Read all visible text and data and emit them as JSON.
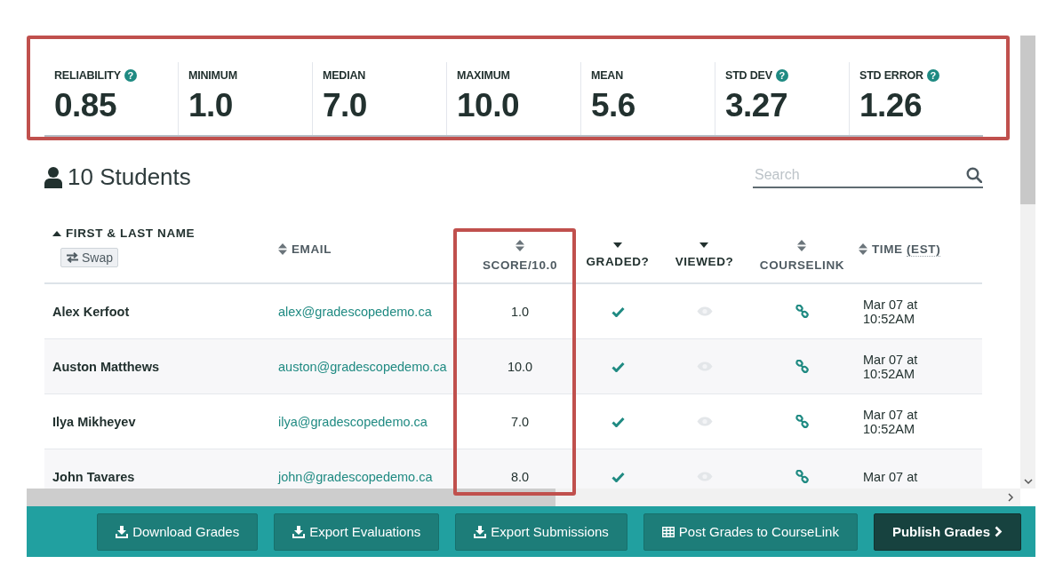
{
  "stats": {
    "highlighted": true,
    "items": [
      {
        "label": "RELIABILITY",
        "value": "0.85",
        "help": "?"
      },
      {
        "label": "MINIMUM",
        "value": "1.0"
      },
      {
        "label": "MEDIAN",
        "value": "7.0"
      },
      {
        "label": "MAXIMUM",
        "value": "10.0"
      },
      {
        "label": "MEAN",
        "value": "5.6"
      },
      {
        "label": "STD DEV",
        "value": "3.27",
        "help": "?"
      },
      {
        "label": "STD ERROR",
        "value": "1.26",
        "help": "?"
      }
    ]
  },
  "students": {
    "title": "10 Students"
  },
  "search": {
    "placeholder": "Search"
  },
  "table": {
    "columns": [
      {
        "label": "FIRST & LAST NAME",
        "kind": "name",
        "sorted_ascending": true,
        "sorted_descending": false,
        "action": "Swap"
      },
      {
        "label": "EMAIL",
        "kind": "email",
        "sorted_ascending": false,
        "sorted_descending": false
      },
      {
        "label": "SCORE/10.0",
        "kind": "score",
        "sorted_ascending": false,
        "sorted_descending": false,
        "highlighted": true
      },
      {
        "label": "GRADED?",
        "kind": "graded",
        "sorted_ascending": false,
        "sorted_descending": true
      },
      {
        "label": "VIEWED?",
        "kind": "viewed",
        "sorted_ascending": false,
        "sorted_descending": true
      },
      {
        "label": "COURSELINK",
        "kind": "courselink",
        "sorted_ascending": false,
        "sorted_descending": false
      },
      {
        "label": "TIME",
        "abbr": "(EST)",
        "kind": "time",
        "sorted_ascending": false,
        "sorted_descending": false
      }
    ],
    "rows": [
      {
        "name": "Alex Kerfoot",
        "email": "alex@gradescopedemo.ca",
        "score": "1.0",
        "graded": true,
        "viewed": false,
        "linked": true,
        "time": "Mar 07 at 10:52AM"
      },
      {
        "name": "Auston Matthews",
        "email": "auston@gradescopedemo.ca",
        "score": "10.0",
        "graded": true,
        "viewed": false,
        "linked": true,
        "time": "Mar 07 at 10:52AM"
      },
      {
        "name": "Ilya Mikheyev",
        "email": "ilya@gradescopedemo.ca",
        "score": "7.0",
        "graded": true,
        "viewed": false,
        "linked": true,
        "time": "Mar 07 at 10:52AM"
      },
      {
        "name": "John Tavares",
        "email": "john@gradescopedemo.ca",
        "score": "8.0",
        "graded": true,
        "viewed": false,
        "linked": true,
        "time": "Mar 07 at"
      }
    ]
  },
  "buttons": [
    {
      "label": "Download Grades",
      "kind": "download"
    },
    {
      "label": "Export Evaluations",
      "kind": "download"
    },
    {
      "label": "Export Submissions",
      "kind": "download"
    },
    {
      "label": "Post Grades to CourseLink",
      "kind": "post"
    },
    {
      "label": "Publish Grades",
      "kind": "publish"
    }
  ]
}
